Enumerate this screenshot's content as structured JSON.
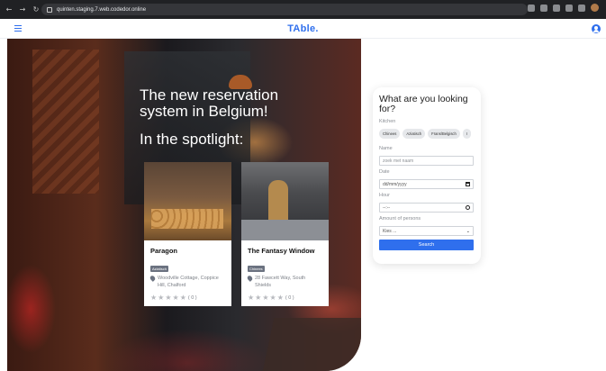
{
  "browser": {
    "url": "quinten.staging.7.web.codedor.online",
    "nav_icons": [
      "back-icon",
      "forward-icon",
      "reload-icon"
    ]
  },
  "header": {
    "logo": "TAble.",
    "menu_icon": "hamburger-menu-icon",
    "user_icon": "user-account-icon"
  },
  "hero": {
    "title": "The new reservation system in Belgium!",
    "spotlight": "In the spotlight:"
  },
  "restaurants": [
    {
      "name": "Paragon",
      "tag": "Aziatisch",
      "address": "Woodville Cottage, Coppice Hill, Chalford",
      "rating": 0,
      "rating_label": "( 0 )"
    },
    {
      "name": "The Fantasy Window",
      "tag": "Chinees",
      "address": "28 Fawcett Way, South Shields",
      "rating": 0,
      "rating_label": "( 0 )"
    }
  ],
  "search": {
    "title": "What are you looking for?",
    "kitchen_label": "Kitchen",
    "chips": [
      "Chinees",
      "Aziatisch",
      "Frans/Belgisch",
      "I"
    ],
    "name_label": "Name",
    "name_placeholder": "zoek met naam",
    "date_label": "Date",
    "date_placeholder": "dd/mm/yyyy",
    "hour_label": "Hour",
    "hour_placeholder": "--:--",
    "persons_label": "Amount of persons",
    "persons_value": "Kies ...",
    "button": "Search"
  },
  "colors": {
    "brand": "#2f6fed",
    "tag": "#6b7280"
  }
}
